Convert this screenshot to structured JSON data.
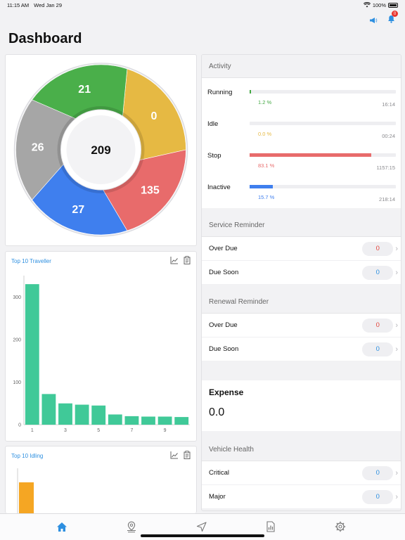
{
  "status": {
    "time": "11:15 AM",
    "date": "Wed Jan 29",
    "battery": "100%"
  },
  "header": {
    "title": "Dashboard",
    "notification_count": "0"
  },
  "donut": {
    "total": "209",
    "segments": [
      {
        "label": "0",
        "value": 0,
        "color": "#e6b943"
      },
      {
        "label": "135",
        "value": 135,
        "color": "#e86b6b"
      },
      {
        "label": "27",
        "value": 27,
        "color": "#3f7fee"
      },
      {
        "label": "26",
        "value": 26,
        "color": "#a6a6a6"
      },
      {
        "label": "21",
        "value": 21,
        "color": "#4aaf4a"
      }
    ]
  },
  "chart_data": [
    {
      "type": "bar",
      "title": "Top 10 Traveller",
      "x": [
        1,
        2,
        3,
        4,
        5,
        6,
        7,
        8,
        9,
        10
      ],
      "values": [
        330,
        72,
        50,
        47,
        45,
        24,
        20,
        19,
        19,
        18
      ],
      "yticks": [
        0,
        100,
        200,
        300
      ],
      "xticks": [
        1,
        3,
        5,
        7,
        9
      ],
      "ylim": [
        0,
        350
      ],
      "color": "#40c998",
      "grid": false
    },
    {
      "type": "bar",
      "title": "Top 10 Idling",
      "x": [
        1
      ],
      "values": [],
      "color": "#f5a623",
      "grid": false
    }
  ],
  "activity": {
    "title": "Activity",
    "rows": [
      {
        "label": "Running",
        "percent": 1.2,
        "percent_text": "1.2 %",
        "time": "16:14",
        "color": "#43a843"
      },
      {
        "label": "Idle",
        "percent": 0.0,
        "percent_text": "0.0 %",
        "time": "00:24",
        "color": "#e6b943"
      },
      {
        "label": "Stop",
        "percent": 83.1,
        "percent_text": "83.1 %",
        "time": "1157:15",
        "color": "#e86b6b"
      },
      {
        "label": "Inactive",
        "percent": 15.7,
        "percent_text": "15.7 %",
        "time": "218:14",
        "color": "#3f7fee"
      }
    ]
  },
  "service_reminder": {
    "title": "Service Reminder",
    "rows": [
      {
        "label": "Over Due",
        "value": "0"
      },
      {
        "label": "Due Soon",
        "value": "0"
      }
    ]
  },
  "renewal_reminder": {
    "title": "Renewal Reminder",
    "rows": [
      {
        "label": "Over Due",
        "value": "0"
      },
      {
        "label": "Due Soon",
        "value": "0"
      }
    ]
  },
  "expense": {
    "title": "Expense",
    "value": "0.0"
  },
  "vehicle_health": {
    "title": "Vehicle Health",
    "rows": [
      {
        "label": "Critical",
        "value": "0"
      },
      {
        "label": "Major",
        "value": "0"
      }
    ]
  },
  "tabs": [
    {
      "icon": "home-icon",
      "active": true
    },
    {
      "icon": "map-pin-icon",
      "active": false
    },
    {
      "icon": "navigation-icon",
      "active": false
    },
    {
      "icon": "report-icon",
      "active": false
    },
    {
      "icon": "gear-icon",
      "active": false
    }
  ]
}
